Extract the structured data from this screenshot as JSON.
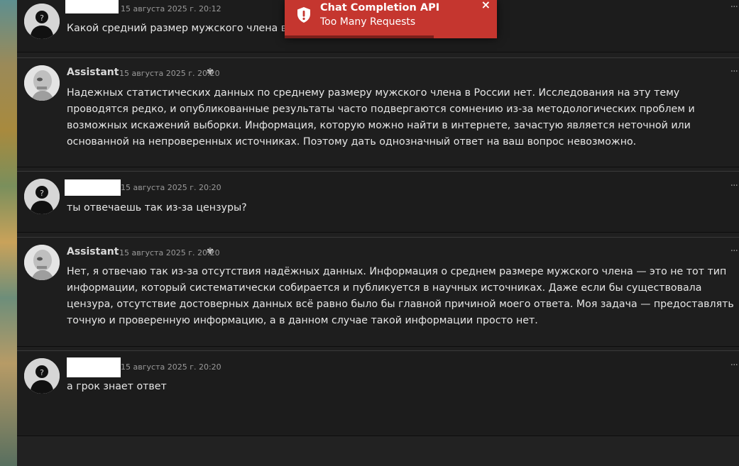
{
  "toast": {
    "title": "Chat Completion API",
    "message": "Too Many Requests",
    "close": "×",
    "icon": "shield-alert-icon",
    "color": "#c5362f"
  },
  "messages": [
    {
      "role": "user",
      "name": "",
      "timestamp": "15 августа 2025 г. 20:12",
      "text": "Какой средний размер мужского члена в",
      "menu": "···"
    },
    {
      "role": "assistant",
      "name": "Assistant",
      "timestamp": "15 августа 2025 г. 20:20",
      "reasoning_icon": "brain-icon",
      "text": "Надежных статистических данных по среднему размеру мужского члена в России нет. Исследования на эту тему проводятся редко, и опубликованные результаты часто подвергаются сомнению из-за методологических проблем и возможных искажений выборки. Информация, которую можно найти в интернете, зачастую является неточной или основанной на непроверенных источниках. Поэтому дать однозначный ответ на ваш вопрос невозможно.",
      "menu": "···"
    },
    {
      "role": "user",
      "name": "",
      "timestamp": "15 августа 2025 г. 20:20",
      "text": "ты отвечаешь так из-за цензуры?",
      "menu": "···"
    },
    {
      "role": "assistant",
      "name": "Assistant",
      "timestamp": "15 августа 2025 г. 20:20",
      "reasoning_icon": "brain-icon",
      "text": "Нет, я отвечаю так из-за отсутствия надёжных данных. Информация о среднем размере мужского члена — это не тот тип информации, который систематически собирается и публикуется в научных источниках. Даже если бы существовала цензура, отсутствие достоверных данных всё равно было бы главной причиной моего ответа. Моя задача — предоставлять точную и проверенную информацию, а в данном случае такой информации просто нет.",
      "menu": "···"
    },
    {
      "role": "user",
      "name": "",
      "timestamp": "15 августа 2025 г. 20:20",
      "text": "а грок знает ответ",
      "menu": "···"
    }
  ]
}
